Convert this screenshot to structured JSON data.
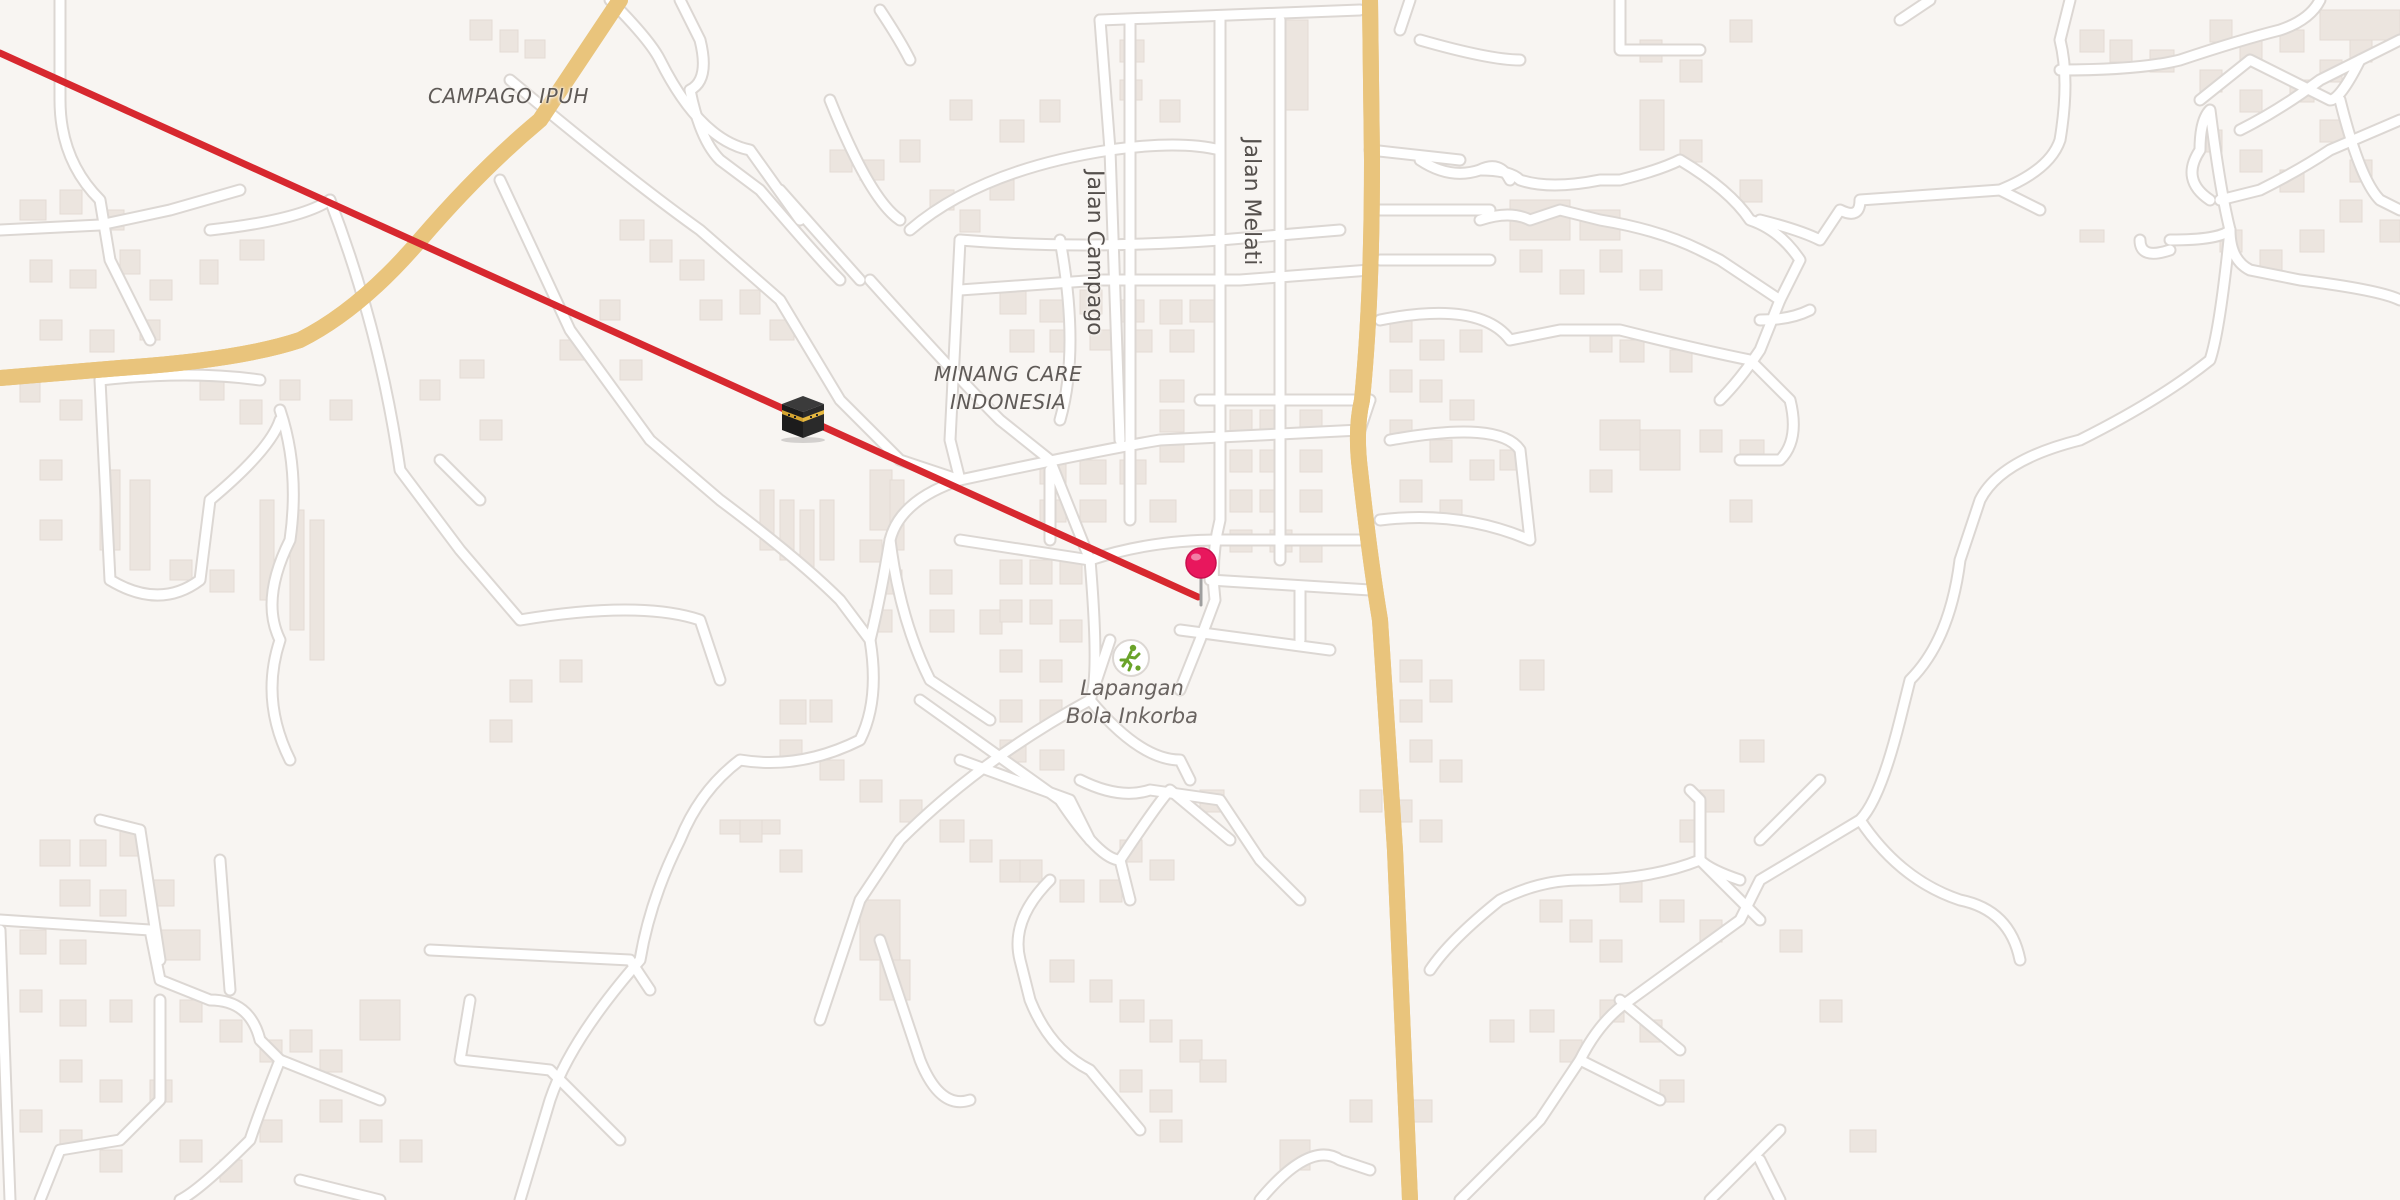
{
  "map": {
    "labels": {
      "area_campago_ipuh": "CAMPAGO IPUH",
      "area_minang_care_line1": "MINANG CARE",
      "area_minang_care_line2": "INDONESIA",
      "street_jalan_campago": "Jalan Campago",
      "street_jalan_melati": "Jalan Melati",
      "poi_lapangan_line1": "Lapangan",
      "poi_lapangan_line2": "Bola Inkorba"
    },
    "markers": {
      "kaaba_icon": "kaaba-icon",
      "location_pin": "map-pin-icon",
      "poi_icon": "soccer-field-icon"
    },
    "colors": {
      "background": "#f8f5f2",
      "road": "#ffffff",
      "road_casing": "#dcd7d3",
      "main_road": "#fde3a1",
      "main_road_casing": "#e9c47c",
      "building": "#ece5df",
      "qibla_line": "#d7282f",
      "pin": "#e8175d",
      "poi_icon": "#6aa329"
    }
  }
}
